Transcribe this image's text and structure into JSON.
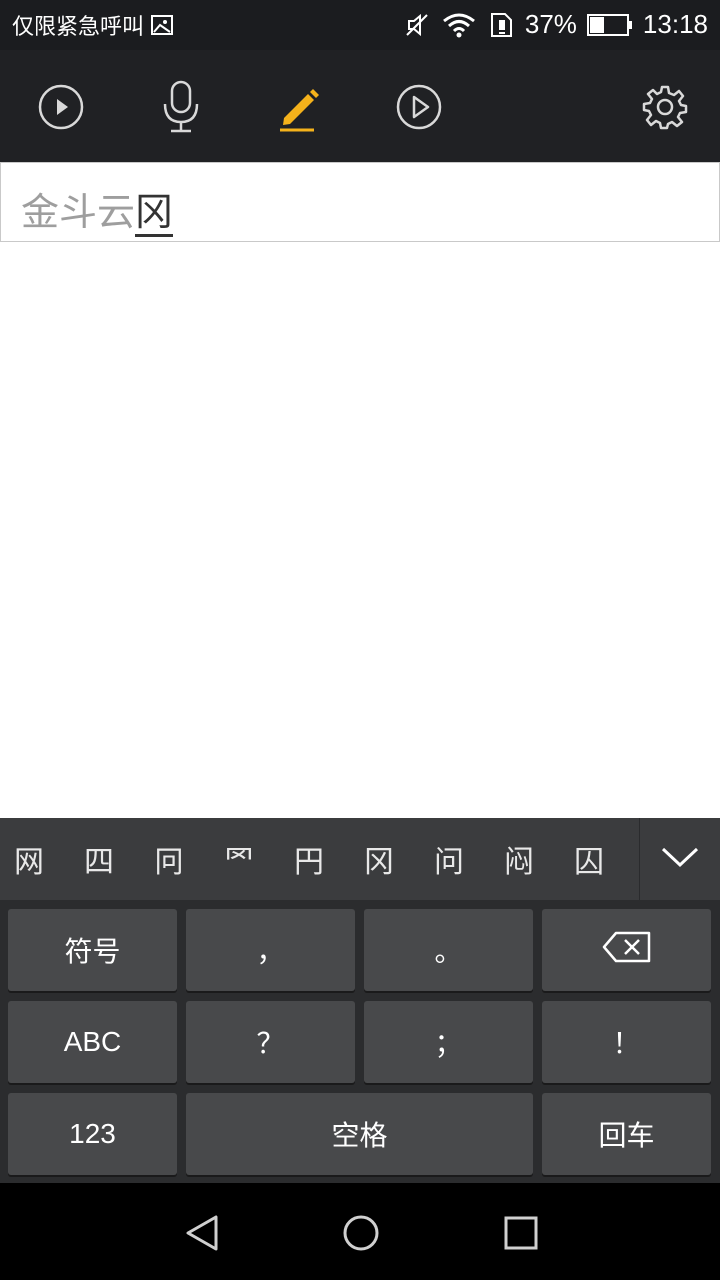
{
  "status_bar": {
    "carrier_text": "仅限紧急呼叫",
    "battery_percent": "37%",
    "time": "13:18",
    "icons": [
      "image-icon",
      "mute-icon",
      "wifi-icon",
      "sim-alert-icon",
      "battery-icon"
    ]
  },
  "toolbar": {
    "buttons": [
      {
        "name": "play-circle-icon"
      },
      {
        "name": "microphone-icon"
      },
      {
        "name": "pencil-icon",
        "active": true,
        "color": "#f5b21b"
      },
      {
        "name": "play-outline-icon"
      },
      {
        "name": "settings-gear-icon"
      }
    ]
  },
  "input": {
    "committed_text": "金斗云",
    "composing_text": "冈"
  },
  "candidates": [
    "网",
    "四",
    "冋",
    "罓",
    "円",
    "冈",
    "问",
    "闷",
    "囚"
  ],
  "keyboard": {
    "keys": {
      "symbols": "符号",
      "comma": "，",
      "period": "。",
      "abc": "ABC",
      "question": "？",
      "semicolon": "；",
      "exclamation": "！",
      "num": "123",
      "space": "空格",
      "enter": "回车"
    }
  },
  "colors": {
    "accent": "#f5b21b",
    "toolbar_bg": "#202124",
    "key_bg": "#48494b"
  }
}
